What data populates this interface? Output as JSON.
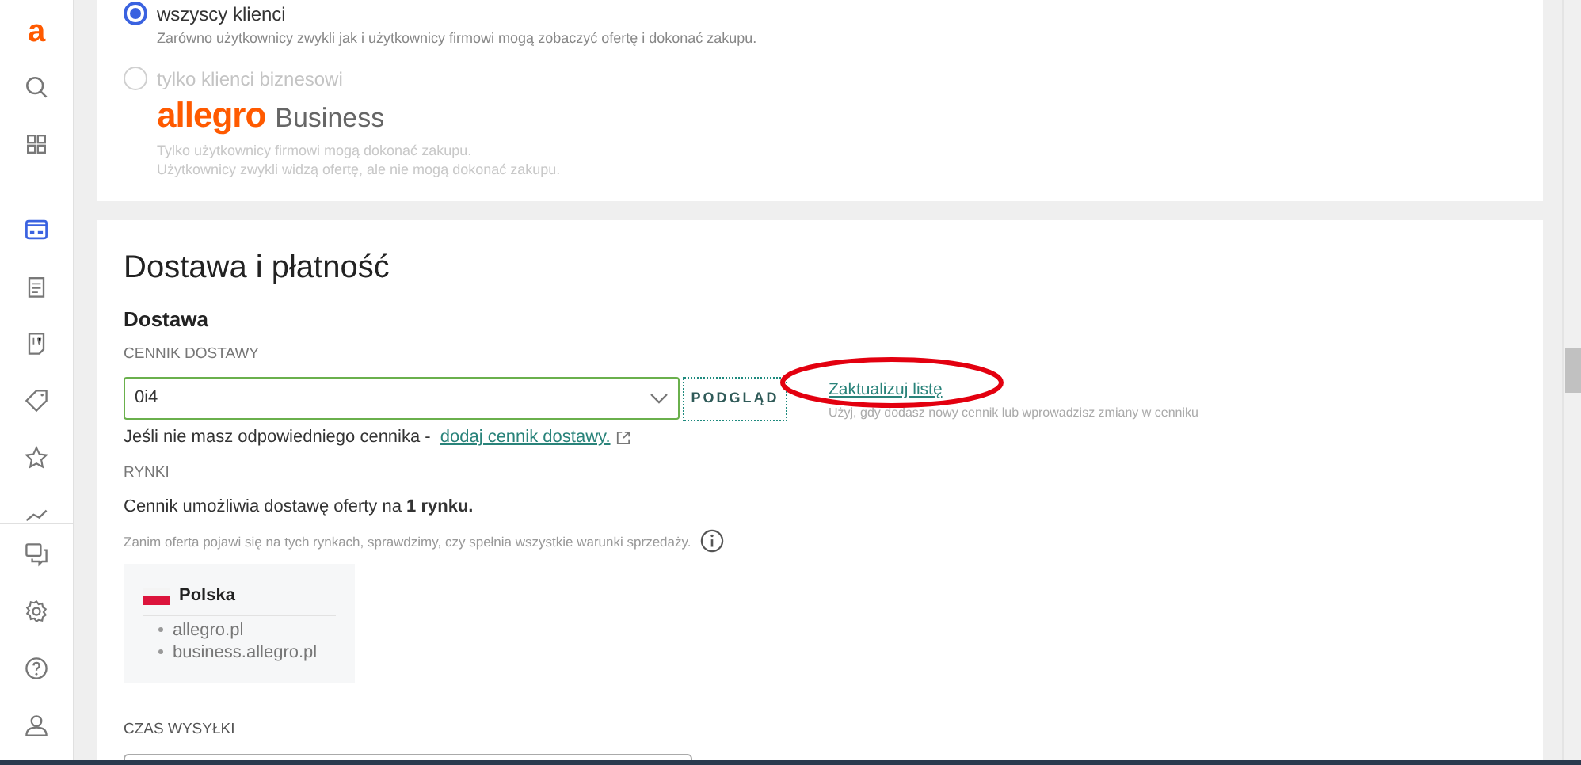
{
  "sidebar": {
    "logo": "a",
    "items": [
      {
        "kind": "search",
        "selected": false
      },
      {
        "kind": "grid",
        "selected": false
      },
      {
        "kind": "calendar",
        "selected": true
      },
      {
        "kind": "clipboard",
        "selected": false
      },
      {
        "kind": "document",
        "selected": false
      },
      {
        "kind": "tag",
        "selected": false
      },
      {
        "kind": "star",
        "selected": false
      },
      {
        "kind": "chart",
        "selected": false
      }
    ],
    "bottom_items": [
      {
        "kind": "chat"
      },
      {
        "kind": "settings"
      },
      {
        "kind": "help"
      },
      {
        "kind": "user"
      }
    ]
  },
  "buyers": {
    "options": [
      {
        "label": "wszyscy klienci",
        "selected": true,
        "description": [
          "Zarówno użytkownicy zwykli jak i użytkownicy firmowi mogą zobaczyć ofertę i dokonać zakupu."
        ]
      },
      {
        "label": "tylko klienci biznesowi",
        "selected": false,
        "logo": {
          "brand": "allegro",
          "suffix": "Business"
        },
        "description": [
          "Tylko użytkownicy firmowi mogą dokonać zakupu.",
          "Użytkownicy zwykli widzą ofertę, ale nie mogą dokonać zakupu."
        ]
      }
    ]
  },
  "delivery": {
    "title": "Dostawa i płatność",
    "subtitle": "Dostawa",
    "price_list_label": "CENNIK DOSTAWY",
    "price_list_value": "0i4",
    "preview_button": "PODGLĄD",
    "refresh_link": "Zaktualizuj listę",
    "refresh_hint": "Użyj, gdy dodasz nowy cennik lub wprowadzisz zmiany w cenniku",
    "missing_text": "Jeśli nie masz odpowiedniego cennika -",
    "missing_link": "dodaj cennik dostawy.",
    "markets_label": "RYNKI",
    "markets_text": "Cennik umożliwia dostawę oferty na **1 rynku.**",
    "markets_hint": "Zanim oferta pojawi się na tych rynkach, sprawdzimy, czy spełnia wszystkie warunki sprzedaży.",
    "market": {
      "country": "Polska",
      "sites": [
        "allegro.pl",
        "business.allegro.pl"
      ]
    },
    "shipping_label": "CZAS WYSYŁKI"
  },
  "highlight": {
    "kind": "ellipse"
  }
}
